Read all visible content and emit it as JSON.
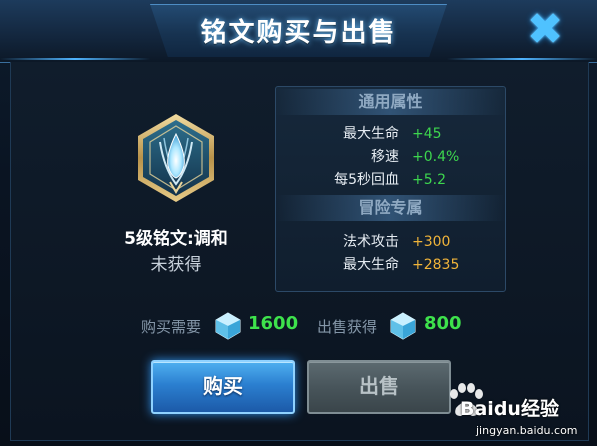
{
  "dialog": {
    "title": "铭文购买与出售",
    "close_icon": "close-x-icon"
  },
  "rune": {
    "icon": "rune-emblem-icon",
    "name": "5级铭文:调和",
    "status": "未获得"
  },
  "stats": {
    "general_header": "通用属性",
    "general": [
      {
        "label": "最大生命",
        "value": "+45"
      },
      {
        "label": "移速",
        "value": "+0.4%"
      },
      {
        "label": "每5秒回血",
        "value": "+5.2"
      }
    ],
    "adventure_header": "冒险专属",
    "adventure": [
      {
        "label": "法术攻击",
        "value": "+300"
      },
      {
        "label": "最大生命",
        "value": "+2835"
      }
    ]
  },
  "price": {
    "buy_label": "购买需要",
    "buy_amount": "1600",
    "sell_label": "出售获得",
    "sell_amount": "800",
    "currency_icon": "crystal-gem-icon"
  },
  "buttons": {
    "buy": "购买",
    "sell": "出售"
  },
  "watermark": {
    "brand": "Baidu经验",
    "url": "jingyan.baidu.com"
  },
  "colors": {
    "accent": "#4fb4ff",
    "positive": "#3dd64e",
    "adventure": "#f0b43a"
  }
}
